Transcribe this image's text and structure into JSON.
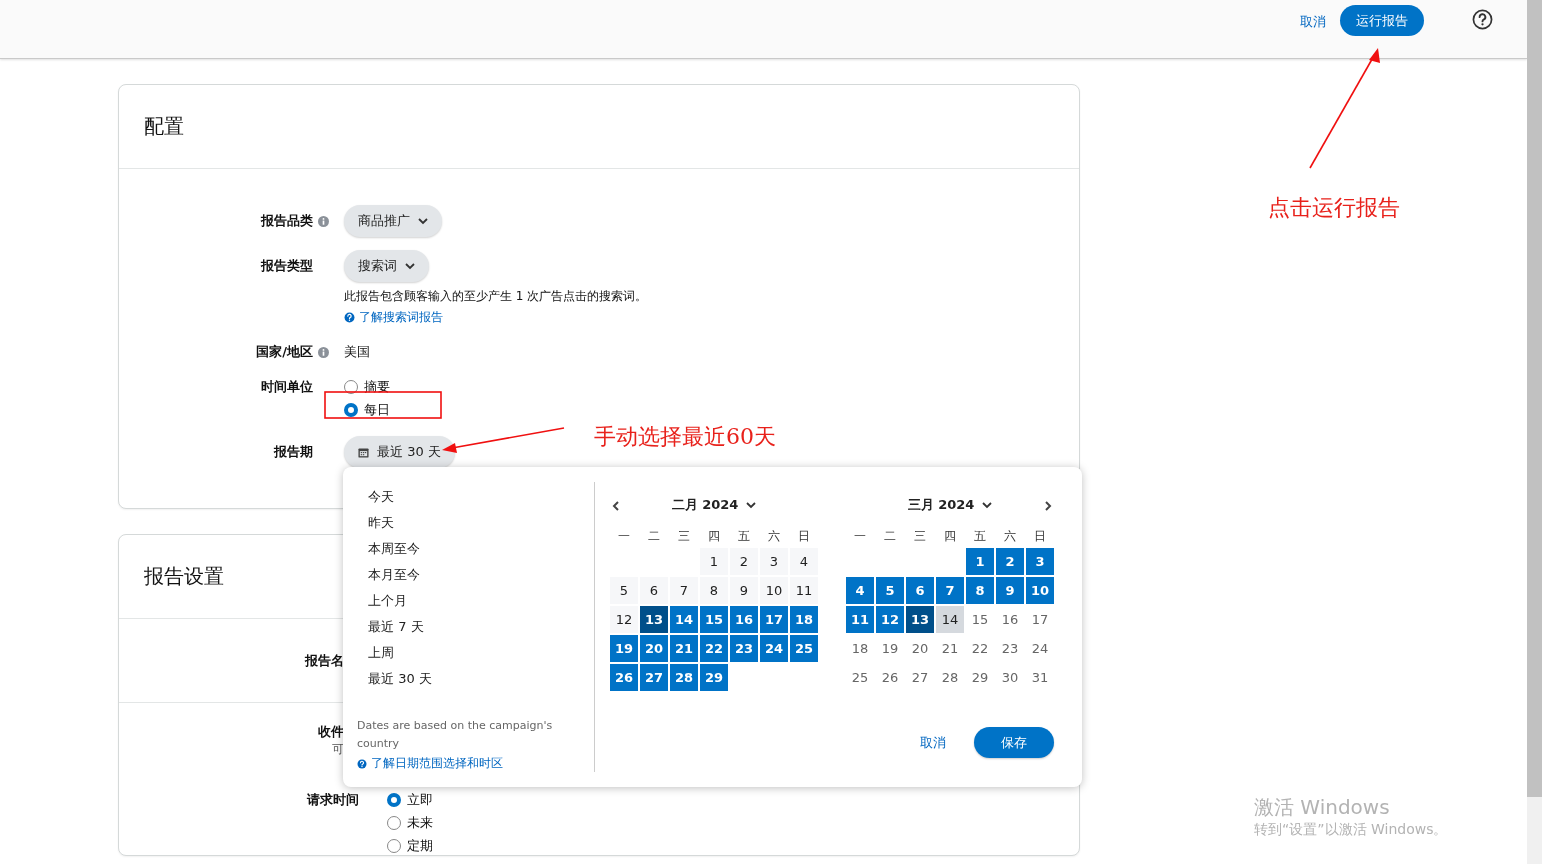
{
  "top_bar": {
    "cancel": "取消",
    "run_button": "运行报告"
  },
  "config_card": {
    "title": "配置",
    "rows": [
      {
        "kind": "dropdown",
        "label": "报告品类",
        "info": true,
        "value": "商品推广"
      },
      {
        "kind": "dropdown",
        "label": "报告类型",
        "info": false,
        "value": "搜索词",
        "description": "此报告包含顾客输入的至少产生 1 次广告点击的搜索词。",
        "link": "了解搜索词报告"
      },
      {
        "kind": "text",
        "label": "国家/地区",
        "info": true,
        "value": "美国"
      },
      {
        "kind": "radio",
        "label": "时间单位",
        "info": false,
        "options": [
          {
            "label": "摘要",
            "selected": false
          },
          {
            "label": "每日",
            "selected": true
          }
        ]
      },
      {
        "kind": "date",
        "label": "报告期",
        "info": false,
        "value": "最近 30 天"
      }
    ]
  },
  "settings_card": {
    "title": "报告设置",
    "rows": [
      {
        "kind": "covered",
        "label": "报告名"
      },
      {
        "kind": "covered",
        "label": "收件",
        "sublabel": "可"
      },
      {
        "kind": "radio",
        "label": "请求时间",
        "options": [
          {
            "label": "立即",
            "selected": true
          },
          {
            "label": "未来",
            "selected": false
          },
          {
            "label": "定期",
            "selected": false
          }
        ]
      }
    ]
  },
  "date_popover": {
    "presets": [
      "今天",
      "昨天",
      "本周至今",
      "本月至今",
      "上个月",
      "最近 7 天",
      "上周",
      "最近 30 天"
    ],
    "note": "Dates are based on the campaign's country",
    "link": "了解日期范围选择和时区",
    "months": [
      {
        "title": "二月 2024",
        "weekdays": [
          "一",
          "二",
          "三",
          "四",
          "五",
          "六",
          "日"
        ],
        "days": [
          {
            "kind": "blank"
          },
          {
            "kind": "blank"
          },
          {
            "kind": "blank"
          },
          {
            "day": "1",
            "kind": "plain"
          },
          {
            "day": "2",
            "kind": "plain"
          },
          {
            "day": "3",
            "kind": "plain"
          },
          {
            "day": "4",
            "kind": "plain"
          },
          {
            "day": "5",
            "kind": "plain"
          },
          {
            "day": "6",
            "kind": "plain"
          },
          {
            "day": "7",
            "kind": "plain"
          },
          {
            "day": "8",
            "kind": "plain"
          },
          {
            "day": "9",
            "kind": "plain"
          },
          {
            "day": "10",
            "kind": "plain"
          },
          {
            "day": "11",
            "kind": "plain"
          },
          {
            "day": "12",
            "kind": "plain"
          },
          {
            "day": "13",
            "kind": "endpoint"
          },
          {
            "day": "14",
            "kind": "range"
          },
          {
            "day": "15",
            "kind": "range"
          },
          {
            "day": "16",
            "kind": "range"
          },
          {
            "day": "17",
            "kind": "range"
          },
          {
            "day": "18",
            "kind": "range"
          },
          {
            "day": "19",
            "kind": "range"
          },
          {
            "day": "20",
            "kind": "range"
          },
          {
            "day": "21",
            "kind": "range"
          },
          {
            "day": "22",
            "kind": "range"
          },
          {
            "day": "23",
            "kind": "range"
          },
          {
            "day": "24",
            "kind": "range"
          },
          {
            "day": "25",
            "kind": "range"
          },
          {
            "day": "26",
            "kind": "range"
          },
          {
            "day": "27",
            "kind": "range"
          },
          {
            "day": "28",
            "kind": "range"
          },
          {
            "day": "29",
            "kind": "range"
          }
        ]
      },
      {
        "title": "三月 2024",
        "weekdays": [
          "一",
          "二",
          "三",
          "四",
          "五",
          "六",
          "日"
        ],
        "days": [
          {
            "kind": "blank"
          },
          {
            "kind": "blank"
          },
          {
            "kind": "blank"
          },
          {
            "kind": "blank"
          },
          {
            "day": "1",
            "kind": "range"
          },
          {
            "day": "2",
            "kind": "range"
          },
          {
            "day": "3",
            "kind": "range"
          },
          {
            "day": "4",
            "kind": "range"
          },
          {
            "day": "5",
            "kind": "range"
          },
          {
            "day": "6",
            "kind": "range"
          },
          {
            "day": "7",
            "kind": "range"
          },
          {
            "day": "8",
            "kind": "range"
          },
          {
            "day": "9",
            "kind": "range"
          },
          {
            "day": "10",
            "kind": "range"
          },
          {
            "day": "11",
            "kind": "range"
          },
          {
            "day": "12",
            "kind": "range"
          },
          {
            "day": "13",
            "kind": "endpoint"
          },
          {
            "day": "14",
            "kind": "today"
          },
          {
            "day": "15",
            "kind": "future"
          },
          {
            "day": "16",
            "kind": "future"
          },
          {
            "day": "17",
            "kind": "future"
          },
          {
            "day": "18",
            "kind": "future"
          },
          {
            "day": "19",
            "kind": "future"
          },
          {
            "day": "20",
            "kind": "future"
          },
          {
            "day": "21",
            "kind": "future"
          },
          {
            "day": "22",
            "kind": "future"
          },
          {
            "day": "23",
            "kind": "future"
          },
          {
            "day": "24",
            "kind": "future"
          },
          {
            "day": "25",
            "kind": "future"
          },
          {
            "day": "26",
            "kind": "future"
          },
          {
            "day": "27",
            "kind": "future"
          },
          {
            "day": "28",
            "kind": "future"
          },
          {
            "day": "29",
            "kind": "future"
          },
          {
            "day": "30",
            "kind": "future"
          },
          {
            "day": "31",
            "kind": "future"
          }
        ]
      }
    ],
    "cancel": "取消",
    "save": "保存"
  },
  "annotations": [
    {
      "text": "点击运行报告"
    },
    {
      "text": "手动选择最近60天"
    }
  ],
  "os_overlay": {
    "title": "激活 Windows",
    "subtitle": "转到“设置”以激活 Windows。"
  }
}
